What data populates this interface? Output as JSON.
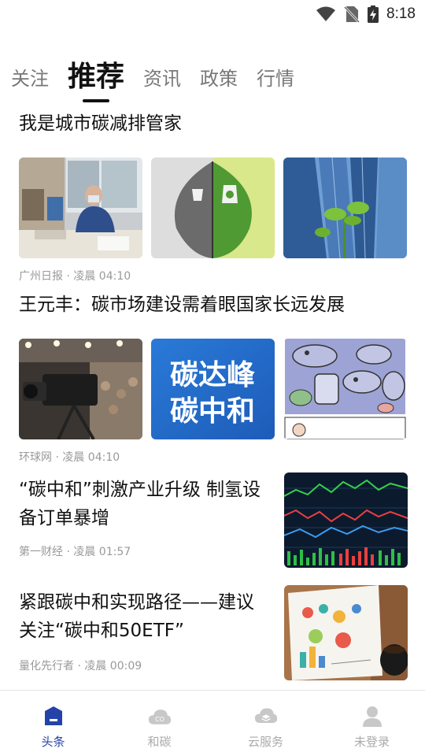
{
  "status_bar": {
    "time": "8:18",
    "icons": [
      "wifi-icon",
      "no-sim-icon",
      "battery-charging-icon"
    ]
  },
  "tabs": [
    {
      "label": "关注",
      "active": false
    },
    {
      "label": "推荐",
      "active": true
    },
    {
      "label": "资讯",
      "active": false
    },
    {
      "label": "政策",
      "active": false
    },
    {
      "label": "行情",
      "active": false
    }
  ],
  "feed": {
    "articles": [
      {
        "title": "我是城市碳减排管家",
        "meta": "广州日报 · 凌晨 04:10",
        "images": [
          "man-working-at-desk-photo",
          "half-dead-half-green-leaf-photo",
          "skyscrapers-with-sprout-photo"
        ]
      },
      {
        "title": "王元丰：碳市场建设需着眼国家长远发展",
        "meta": "环球网 · 凌晨 04:10",
        "images": [
          "tv-camera-conference-photo",
          "carbon-peak-neutral-graphic",
          "cartoon-fish-illustration"
        ],
        "graphic_text": [
          "碳达峰",
          "碳中和"
        ]
      },
      {
        "title": "“碳中和”刺激产业升级 制氢设备订单暴增",
        "meta": "第一财经 · 凌晨 01:57",
        "images": [
          "stock-market-chart-screen-photo"
        ]
      },
      {
        "title": "紧跟碳中和实现路径——建议关注“碳中和50ETF”",
        "meta": "量化先行者 · 凌晨 00:09",
        "images": [
          "notebook-infographic-coffee-photo"
        ]
      }
    ]
  },
  "bottom_nav": [
    {
      "label": "头条",
      "icon": "headline-icon",
      "active": true
    },
    {
      "label": "和碳",
      "icon": "co2-cloud-icon",
      "active": false
    },
    {
      "label": "云服务",
      "icon": "cloud-layers-icon",
      "active": false
    },
    {
      "label": "未登录",
      "icon": "user-icon",
      "active": false
    }
  ],
  "colors": {
    "accent": "#2442a8",
    "inactive": "#aaaaaa",
    "meta": "#999999"
  }
}
